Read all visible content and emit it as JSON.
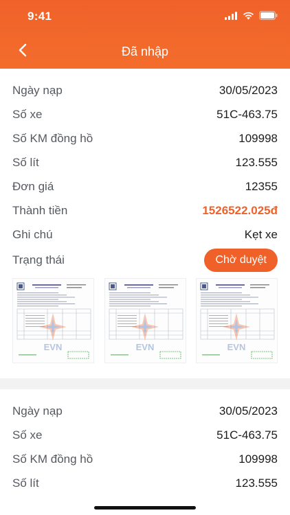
{
  "status_bar": {
    "time": "9:41"
  },
  "nav": {
    "title": "Đã nhập"
  },
  "entry1": {
    "rows": [
      {
        "label": "Ngày nạp",
        "value": "30/05/2023"
      },
      {
        "label": "Số xe",
        "value": "51C-463.75"
      },
      {
        "label": "Số KM đồng hồ",
        "value": "109998"
      },
      {
        "label": "Số lít",
        "value": "123.555"
      },
      {
        "label": "Đơn giá",
        "value": "12355"
      },
      {
        "label": "Thành tiền",
        "value": "1526522.025đ"
      },
      {
        "label": "Ghi chú",
        "value": "Kẹt xe"
      }
    ],
    "status_label": "Trạng thái",
    "status_value": "Chờ duyệt",
    "receipt_watermark": "EVN"
  },
  "entry2": {
    "rows": [
      {
        "label": "Ngày nạp",
        "value": "30/05/2023"
      },
      {
        "label": "Số xe",
        "value": "51C-463.75"
      },
      {
        "label": "Số KM đồng hồ",
        "value": "109998"
      },
      {
        "label": "Số lít",
        "value": "123.555"
      }
    ]
  },
  "colors": {
    "accent": "#f0612a",
    "divider": "#f2f2f2"
  }
}
